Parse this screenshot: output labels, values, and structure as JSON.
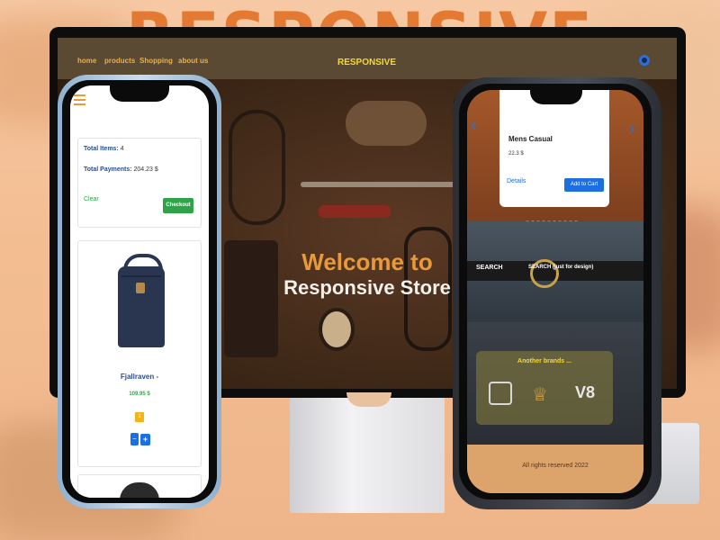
{
  "hero_word": "RESPONSIVE",
  "desktop": {
    "nav": [
      "home",
      "products",
      "Shopping",
      "about us"
    ],
    "brand": "RESPONSIVE",
    "welcome_line1": "Welcome to",
    "welcome_line2": "Responsive Store"
  },
  "left_phone": {
    "total_items_label": "Total Items:",
    "total_items_value": "4",
    "total_payments_label": "Total Payments:",
    "total_payments_value": "204.23 $",
    "clear_label": "Clear",
    "checkout_label": "Checkout",
    "product_name": "Fjallraven -",
    "product_price": "109.95 $",
    "quantity": "1",
    "minus_label": "−",
    "plus_label": "+"
  },
  "right_phone": {
    "product_name": "Mens Casual",
    "product_price": "22.3 $",
    "details_label": "Details",
    "add_to_cart_label": "Add to Cart",
    "search_label": "SEARCH",
    "search_note": "SEARCH (just for design)",
    "brands_title": "Another brands ...",
    "footer": "All rights reserved 2022"
  },
  "colors": {
    "accent_orange": "#e8993a",
    "brand_yellow": "#f5d73a",
    "button_blue": "#1c6fe0",
    "button_green": "#2fa34a"
  }
}
